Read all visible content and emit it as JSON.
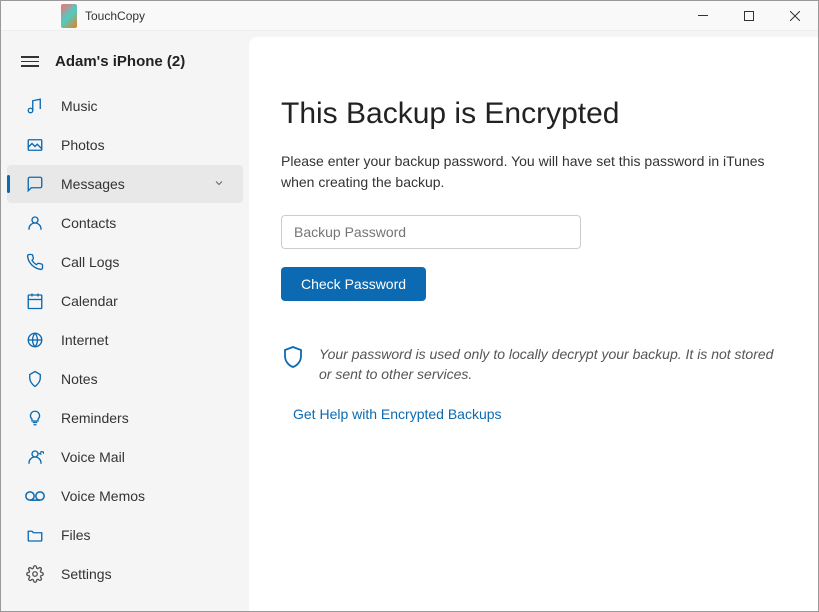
{
  "titlebar": {
    "app_name": "TouchCopy"
  },
  "device": {
    "name": "Adam's iPhone (2)"
  },
  "sidebar": {
    "items": [
      {
        "label": "Music"
      },
      {
        "label": "Photos"
      },
      {
        "label": "Messages"
      },
      {
        "label": "Contacts"
      },
      {
        "label": "Call Logs"
      },
      {
        "label": "Calendar"
      },
      {
        "label": "Internet"
      },
      {
        "label": "Notes"
      },
      {
        "label": "Reminders"
      },
      {
        "label": "Voice Mail"
      },
      {
        "label": "Voice Memos"
      },
      {
        "label": "Files"
      },
      {
        "label": "Settings"
      }
    ]
  },
  "main": {
    "heading": "This Backup is Encrypted",
    "description": "Please enter your backup password. You will have set this password in iTunes when creating the backup.",
    "password_placeholder": "Backup Password",
    "check_button": "Check Password",
    "info_text": "Your password is used only to locally decrypt your backup. It is not stored or sent to other services.",
    "help_link": "Get Help with Encrypted Backups"
  }
}
